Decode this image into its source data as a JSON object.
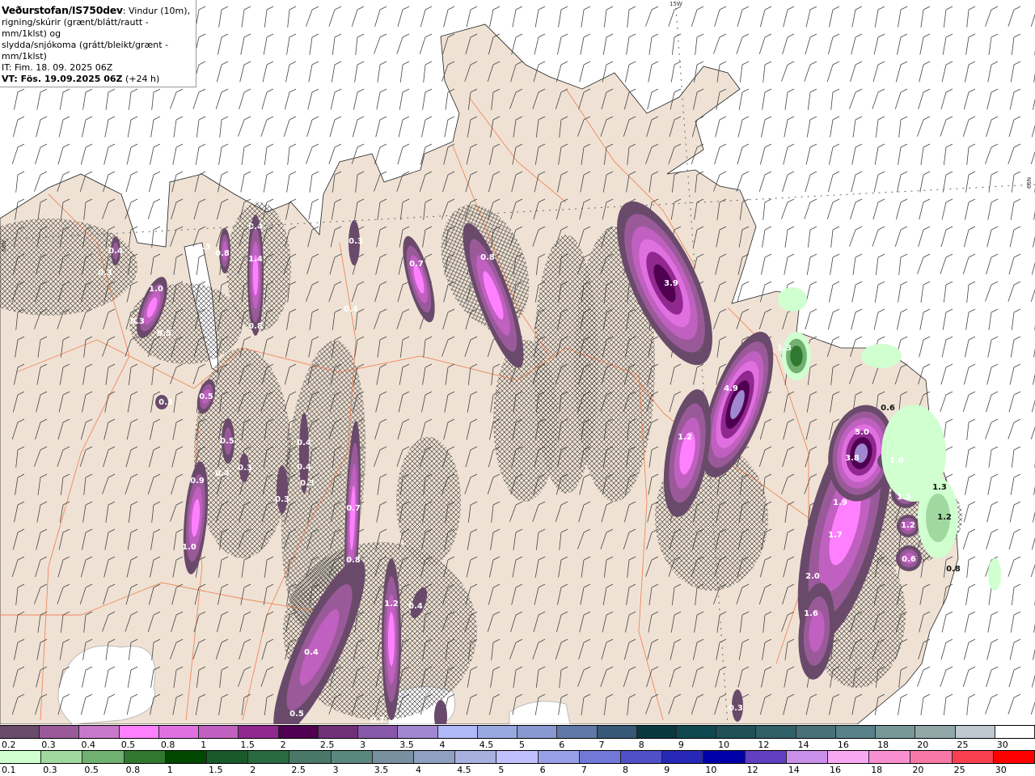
{
  "title": {
    "source": "Veðurstofan/IS750dev",
    "description_line1": ": Vindur (10m),",
    "description_line2": "rigning/skúrir (grænt/blátt/rautt - mm/1klst) og",
    "description_line3": "slydda/snjókoma (grátt/bleikt/grænt - mm/1klst)",
    "issue_time": "IT: Fim. 18. 09. 2025 06Z",
    "valid_time_label": "VT: Fös. 19.09.2025 06Z",
    "lead_time": " (+24 h)"
  },
  "grid_labels": {
    "meridian": "15W",
    "parallel_left": "66N",
    "parallel_right": "66N"
  },
  "map": {
    "land_color": "#efe2d4",
    "sea_color": "#ffffff",
    "road_color": "#f07040",
    "precip_values": [
      "0.4",
      "0.3",
      "1.0",
      "0.3",
      "0.5",
      "0.5",
      "0.3",
      "0.8",
      "0.3",
      "0.4",
      "1.4",
      "0.8",
      "0.3",
      "0.7",
      "0.8",
      "3.9",
      "4.9",
      "1.3",
      "1.2",
      "0.5",
      "0.4",
      "0.3",
      "0.9",
      "1.0",
      "0.4",
      "0.4",
      "0.3",
      "0.3",
      "0.7",
      "0.8",
      "1.2",
      "0.4",
      "0.4",
      "0.5",
      "0.7",
      "0.3",
      "5.0",
      "3.8",
      "0.6",
      "1.0",
      "1.9",
      "1.5",
      "1.2",
      "1.7",
      "0.6",
      "2.0",
      "1.6",
      "1.3",
      "1.2",
      "0.8",
      "0.4"
    ]
  },
  "legend_snow": {
    "labels": [
      "0.2",
      "0.3",
      "0.4",
      "0.5",
      "0.8",
      "1",
      "1.5",
      "2",
      "2.5",
      "3",
      "3.5",
      "4",
      "4.5",
      "5",
      "6",
      "7",
      "8",
      "9",
      "10",
      "12",
      "14",
      "16",
      "18",
      "20",
      "25",
      "30"
    ],
    "colors": [
      "#6a4a6a",
      "#9a5a9a",
      "#c878c8",
      "#ff80ff",
      "#e070e0",
      "#c060c0",
      "#902890",
      "#500050",
      "#703078",
      "#8858a8",
      "#a088d0",
      "#b0b8f8",
      "#98a8e0",
      "#8898d0",
      "#6078a8",
      "#385878",
      "#083840",
      "#104850",
      "#205058",
      "#306068",
      "#487078",
      "#588088",
      "#789898",
      "#90a8a8",
      "#c0c8d0",
      "#ffffff"
    ]
  },
  "legend_rain": {
    "labels": [
      "0.1",
      "0.3",
      "0.5",
      "0.8",
      "1",
      "1.5",
      "2",
      "2.5",
      "3",
      "3.5",
      "4",
      "4.5",
      "5",
      "6",
      "7",
      "8",
      "9",
      "10",
      "12",
      "14",
      "16",
      "18",
      "20",
      "25",
      "30"
    ],
    "colors": [
      "#d0ffd0",
      "#a0d8a0",
      "#70b070",
      "#307830",
      "#004800",
      "#1a5a2a",
      "#2a6a40",
      "#4a7868",
      "#5a8880",
      "#7890a0",
      "#90a0c0",
      "#a8b0e0",
      "#c0c0ff",
      "#98a0e8",
      "#7078d8",
      "#5050c8",
      "#2828b8",
      "#0000a8",
      "#6040c0",
      "#c890e8",
      "#f8a8f0",
      "#f890d0",
      "#f878a8",
      "#f84050",
      "#ff0000"
    ]
  }
}
